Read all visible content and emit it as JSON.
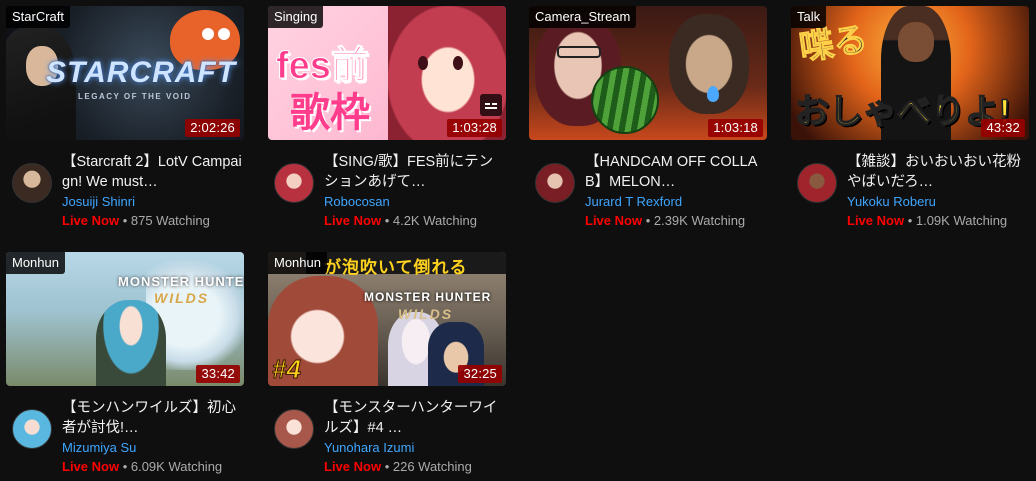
{
  "live_label": "Live Now",
  "separator": " • ",
  "cards": [
    {
      "topic": "StarCraft",
      "duration": "2:02:26",
      "title": "【Starcraft 2】LotV Campaign! We must…",
      "channel": "Josuiji Shinri",
      "watching": "875 Watching",
      "thumb_logo": "STARCRAFT",
      "thumb_sub": "LEGACY OF THE VOID"
    },
    {
      "topic": "Singing",
      "duration": "1:03:28",
      "title": "【SING/歌】FES前にテンションあげて…",
      "channel": "Robocosan",
      "watching": "4.2K Watching",
      "thumb_logo": "fes前",
      "thumb_sub": "歌枠"
    },
    {
      "topic": "Camera_Stream",
      "duration": "1:03:18",
      "title": "【HANDCAM OFF COLLAB】MELON…",
      "channel": "Jurard T Rexford",
      "watching": "2.39K Watching"
    },
    {
      "topic": "Talk",
      "duration": "43:32",
      "title": "【雑談】おいおいおい花粉やばいだろ…",
      "channel": "Yukoku Roberu",
      "watching": "1.09K Watching",
      "thumb_logo": "喋る",
      "thumb_sub": "おしゃべりよ!"
    },
    {
      "topic": "Monhun",
      "duration": "33:42",
      "title": "【モンハンワイルズ】初心者が討伐!…",
      "channel": "Mizumiya Su",
      "watching": "6.09K Watching",
      "thumb_logo": "MONSTER HUNTER",
      "thumb_sub": "WILDS"
    },
    {
      "topic": "Monhun",
      "duration": "32:25",
      "title": "【モンスターハンターワイルズ】#4 …",
      "channel": "Yunohara Izumi",
      "watching": "226 Watching",
      "thumb_logo": "MONSTER HUNTER",
      "thumb_sub": "WILDS",
      "thumb_banner": "が泡吹いて倒れる",
      "thumb_num": "#4"
    }
  ],
  "colors": {
    "live": "#ff0000",
    "channel": "#3ea6ff",
    "duration_bg": "#960000",
    "background": "#0f0f0f"
  }
}
